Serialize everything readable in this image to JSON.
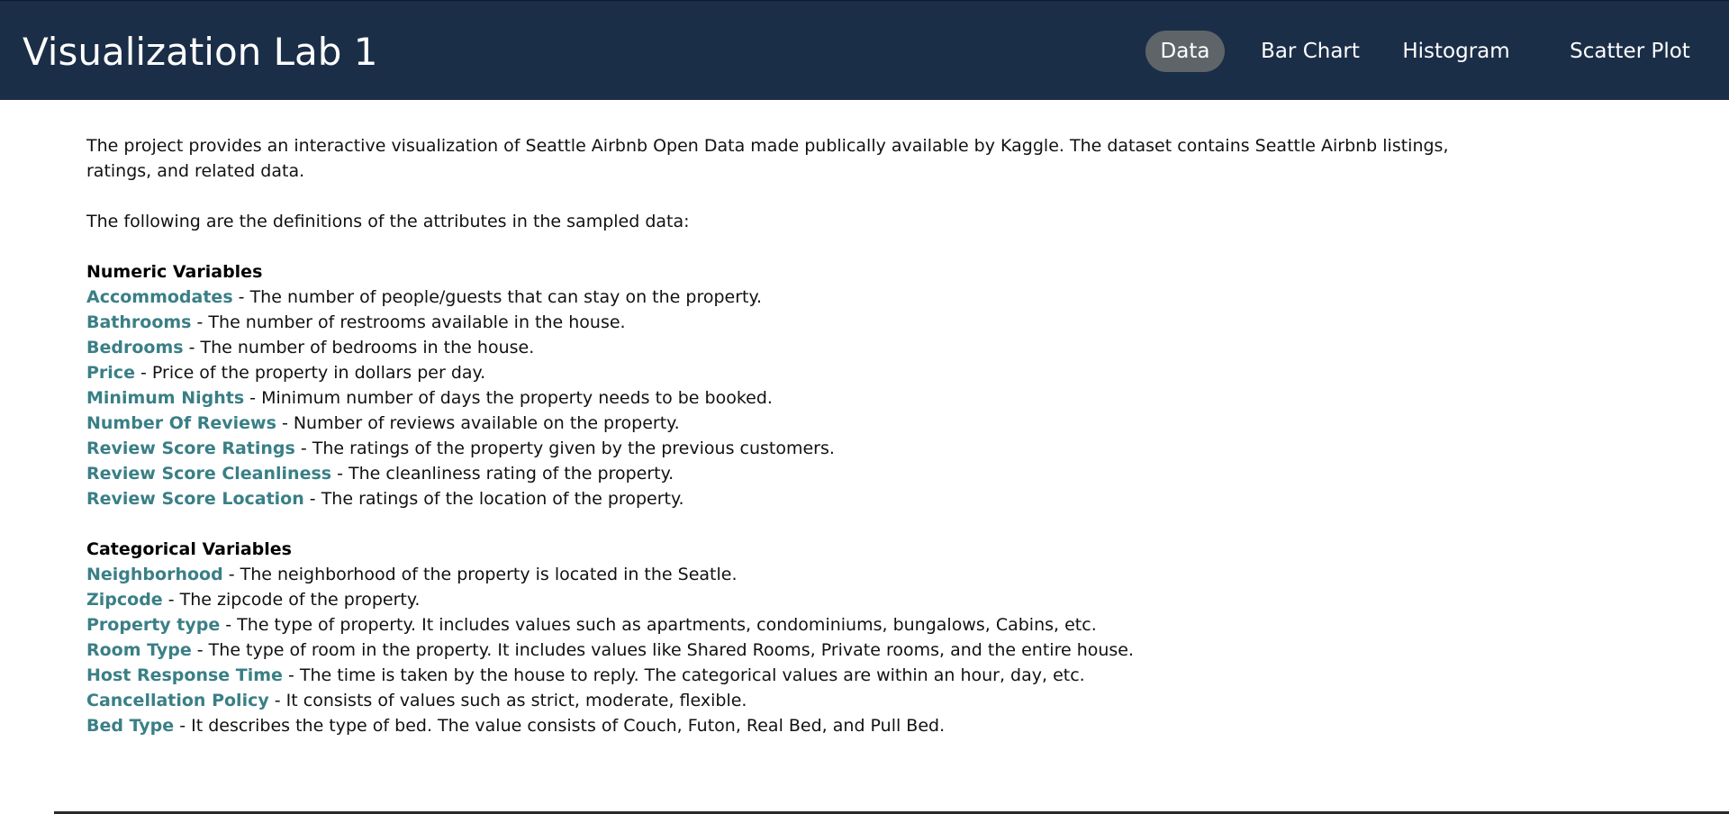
{
  "header": {
    "title": "Visualization Lab 1",
    "nav": [
      {
        "label": "Data",
        "active": true
      },
      {
        "label": "Bar Chart",
        "active": false
      },
      {
        "label": "Histogram",
        "active": false
      },
      {
        "label": "Scatter Plot",
        "active": false
      }
    ]
  },
  "main": {
    "intro": "The project provides an interactive visualization of Seattle Airbnb Open Data made publically available by Kaggle. The dataset contains Seattle Airbnb listings, ratings, and related data.",
    "defs_intro": "The following are the definitions of the attributes in the sampled data:",
    "numeric": {
      "heading": "Numeric Variables",
      "items": [
        {
          "term": "Accommodates",
          "desc": " - The number of people/guests that can stay on the property."
        },
        {
          "term": "Bathrooms",
          "desc": " - The number of restrooms available in the house."
        },
        {
          "term": "Bedrooms",
          "desc": " - The number of bedrooms in the house."
        },
        {
          "term": "Price",
          "desc": " - Price of the property in dollars per day."
        },
        {
          "term": "Minimum Nights",
          "desc": " - Minimum number of days the property needs to be booked."
        },
        {
          "term": "Number Of Reviews",
          "desc": " - Number of reviews available on the property."
        },
        {
          "term": "Review Score Ratings",
          "desc": " - The ratings of the property given by the previous customers."
        },
        {
          "term": "Review Score Cleanliness",
          "desc": " - The cleanliness rating of the property."
        },
        {
          "term": "Review Score Location",
          "desc": " - The ratings of the location of the property."
        }
      ]
    },
    "categorical": {
      "heading": "Categorical Variables",
      "items": [
        {
          "term": "Neighborhood",
          "desc": " - The neighborhood of the property is located in the Seatle."
        },
        {
          "term": "Zipcode",
          "desc": " - The zipcode of the property."
        },
        {
          "term": "Property type",
          "desc": " - The type of property. It includes values such as apartments, condominiums, bungalows, Cabins, etc."
        },
        {
          "term": "Room Type",
          "desc": " - The type of room in the property. It includes values like Shared Rooms, Private rooms, and the entire house."
        },
        {
          "term": "Host Response Time",
          "desc": " - The time is taken by the house to reply. The categorical values are within an hour, day, etc."
        },
        {
          "term": "Cancellation Policy",
          "desc": " - It consists of values such as strict, moderate, flexible."
        },
        {
          "term": "Bed Type",
          "desc": " - It describes the type of bed. The value consists of Couch, Futon, Real Bed, and Pull Bed."
        }
      ]
    }
  },
  "colors": {
    "header_bg": "#1b2e48",
    "active_pill": "#5f6469",
    "term": "#3a7f86"
  }
}
